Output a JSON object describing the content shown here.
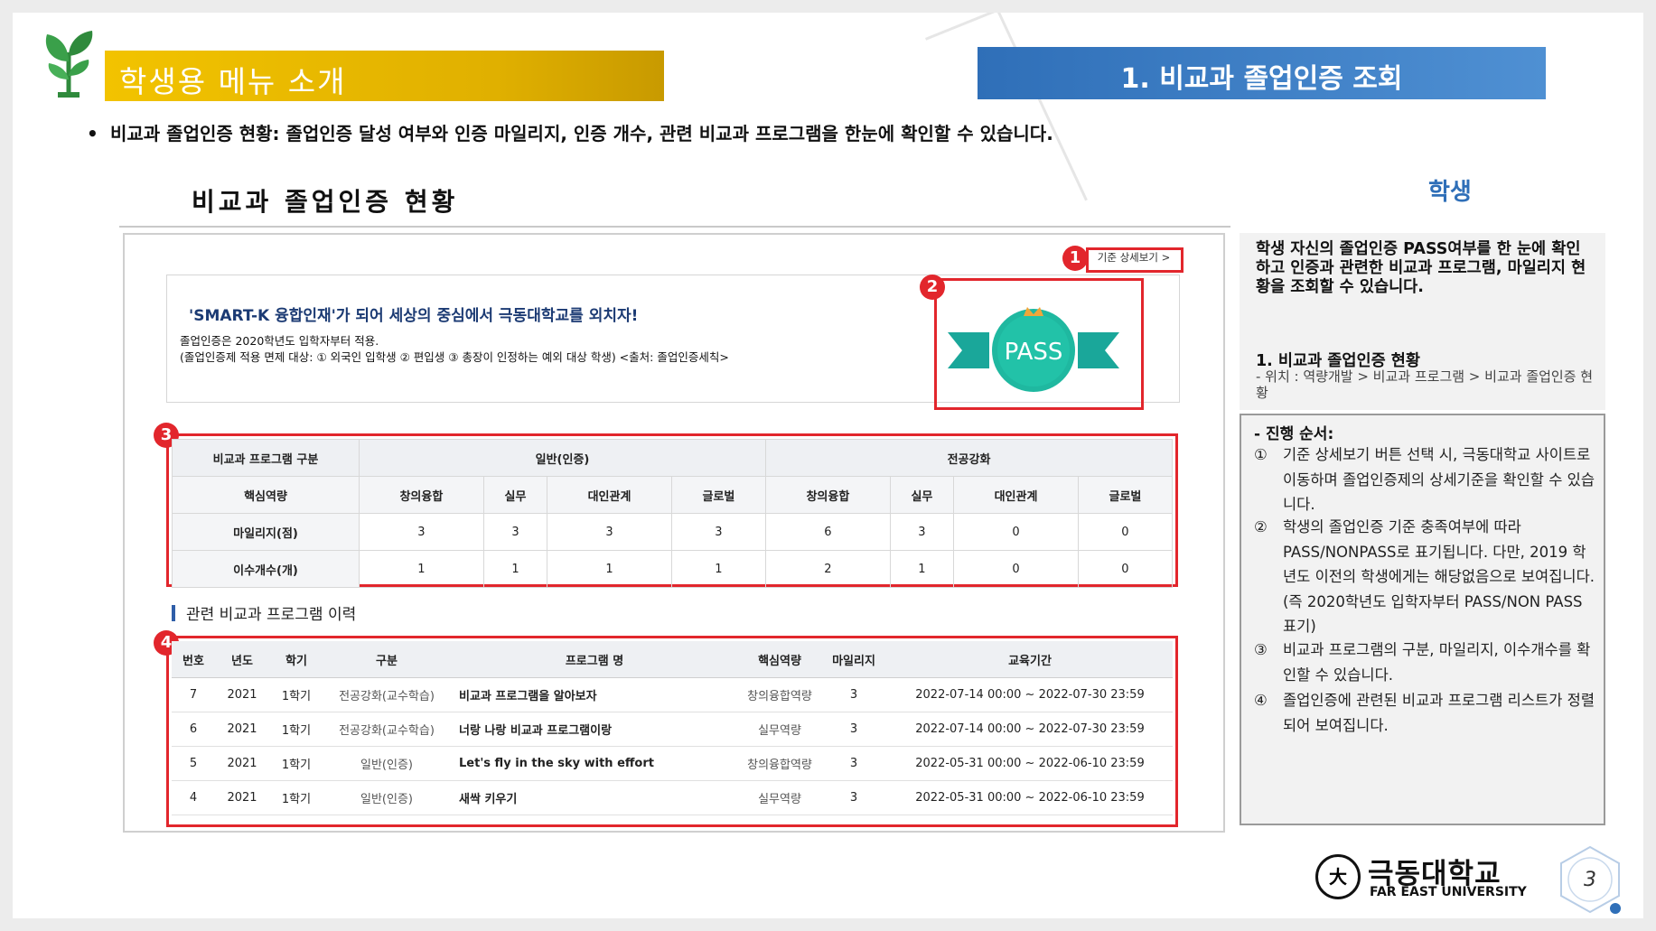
{
  "header": {
    "left_title": "학생용 메뉴 소개",
    "right_title": "1. 비교과 졸업인증 조회"
  },
  "intro": {
    "bullet": "•",
    "text": "비교과 졸업인증 현황: 졸업인증 달성 여부와 인증 마일리지, 인증 개수, 관련 비교과 프로그램을 한눈에 확인할 수 있습니다."
  },
  "screenshot": {
    "title": "비교과 졸업인증 현황",
    "student_tag": "학생",
    "detail_link": "기준 상세보기 >",
    "badges": [
      "1",
      "2",
      "3",
      "4"
    ],
    "banner": {
      "title": "'SMART-K 융합인재'가 되어 세상의 중심에서 극동대학교를 외치자!",
      "line1": "졸업인증은 2020학년도 입학자부터 적용.",
      "line2": "(졸업인증제 적용 면제 대상:  ① 외국인 입학생  ② 편입생  ③ 총장이 인정하는 예외 대상 학생) <출처: 졸업인증세칙>"
    },
    "pass_label": "PASS",
    "summary": {
      "group_header": "비교과 프로그램 구분",
      "general": "일반(인증)",
      "major": "전공강화",
      "competency_header": "핵심역량",
      "competencies": [
        "창의융합",
        "실무",
        "대인관계",
        "글로벌",
        "창의융합",
        "실무",
        "대인관계",
        "글로벌"
      ],
      "rows": [
        {
          "label": "마일리지(점)",
          "values": [
            "3",
            "3",
            "3",
            "3",
            "6",
            "3",
            "0",
            "0"
          ]
        },
        {
          "label": "이수개수(개)",
          "values": [
            "1",
            "1",
            "1",
            "1",
            "2",
            "1",
            "0",
            "0"
          ]
        }
      ]
    },
    "history": {
      "title": "관련 비교과 프로그램 이력",
      "columns": [
        "번호",
        "년도",
        "학기",
        "구분",
        "프로그램 명",
        "핵심역량",
        "마일리지",
        "교육기간"
      ],
      "rows": [
        [
          "7",
          "2021",
          "1학기",
          "전공강화(교수학습)",
          "비교과 프로그램을 알아보자",
          "창의융합역량",
          "3",
          "2022-07-14 00:00 ~ 2022-07-30 23:59"
        ],
        [
          "6",
          "2021",
          "1학기",
          "전공강화(교수학습)",
          "너랑 나랑 비교과 프로그램이랑",
          "실무역량",
          "3",
          "2022-07-14 00:00 ~ 2022-07-30 23:59"
        ],
        [
          "5",
          "2021",
          "1학기",
          "일반(인증)",
          "Let's fly in the sky with effort",
          "창의융합역량",
          "3",
          "2022-05-31 00:00 ~ 2022-06-10 23:59"
        ],
        [
          "4",
          "2021",
          "1학기",
          "일반(인증)",
          "새싹 키우기",
          "실무역량",
          "3",
          "2022-05-31 00:00 ~ 2022-06-10 23:59"
        ]
      ]
    }
  },
  "side": {
    "para": "학생 자신의 졸업인증 PASS여부를 한 눈에 확인하고 인증과 관련한 비교과 프로그램, 마일리지 현황을 조회할 수 있습니다.",
    "heading": "1.  비교과 졸업인증 현황",
    "location": "-  위치 : 역량개발 > 비교과 프로그램 > 비교과 졸업인증 현황",
    "steps_header": "- 진행 순서:",
    "steps": [
      {
        "mark": "①",
        "text": "기준 상세보기 버튼 선택 시, 극동대학교 사이트로 이동하며 졸업인증제의 상세기준을 확인할 수 있습니다."
      },
      {
        "mark": "②",
        "text": "학생의 졸업인증 기준 충족여부에 따라 PASS/NONPASS로 표기됩니다. 다만, 2019 학년도 이전의 학생에게는 해당없음으로 보여집니다. (즉 2020학년도 입학자부터  PASS/NON PASS 표기)"
      },
      {
        "mark": "③",
        "text": "비교과 프로그램의 구분, 마일리지, 이수개수를 확인할 수 있습니다."
      },
      {
        "mark": "④",
        "text": "졸업인증에 관련된 비교과 프로그램 리스트가 정렬되어 보여집니다."
      }
    ]
  },
  "footer": {
    "logo_seal": "大",
    "logo_korean": "극동대학교",
    "logo_english": "FAR EAST UNIVERSITY",
    "page_number": "3"
  },
  "colors": {
    "accent_yellow": "#f2c300",
    "accent_blue": "#3a7bc4",
    "highlight_red": "#e2262c",
    "pass_green": "#1fb8a0"
  }
}
